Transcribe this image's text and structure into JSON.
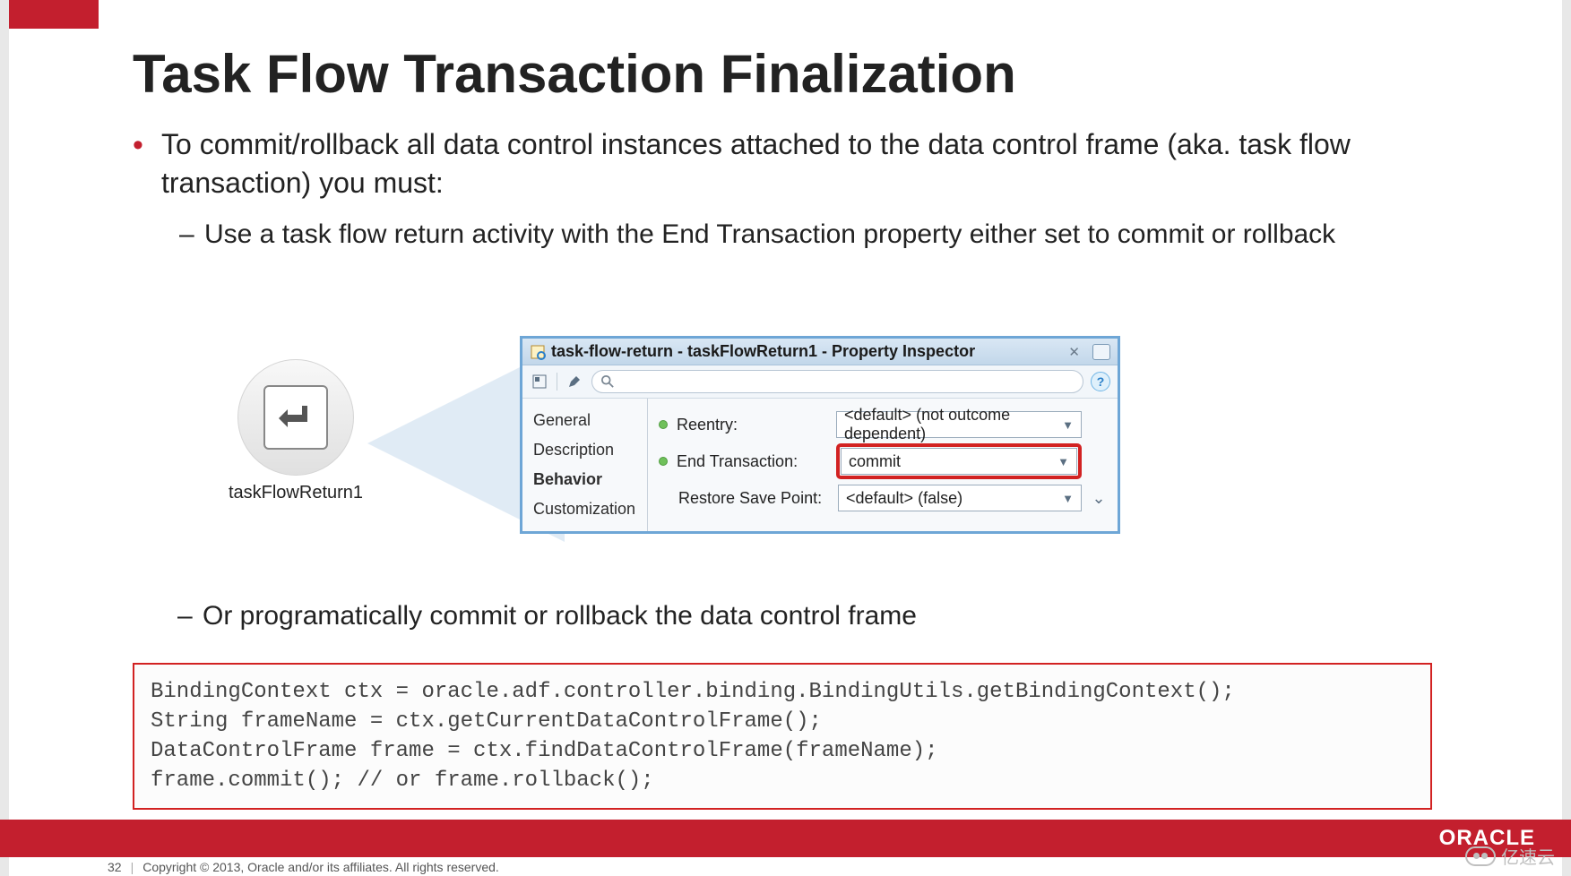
{
  "slide": {
    "title": "Task Flow Transaction Finalization",
    "bullet1": "To commit/rollback all data control instances attached to the data control frame (aka. task flow transaction) you must:",
    "sub1": "Use a task flow return activity with the End Transaction property either set to commit or rollback",
    "sub2": "Or programatically commit or rollback the data control frame"
  },
  "activity": {
    "label": "taskFlowReturn1"
  },
  "inspector": {
    "title": "task-flow-return - taskFlowReturn1 - Property Inspector",
    "tabs": {
      "general": "General",
      "description": "Description",
      "behavior": "Behavior",
      "customization": "Customization"
    },
    "props": {
      "reentry_label": "Reentry:",
      "reentry_value": "<default> (not outcome dependent)",
      "endtx_label": "End Transaction:",
      "endtx_value": "commit",
      "restore_label": "Restore Save Point:",
      "restore_value": "<default> (false)"
    },
    "help": "?"
  },
  "code": {
    "line1": "BindingContext ctx = oracle.adf.controller.binding.BindingUtils.getBindingContext();",
    "line2": "String frameName = ctx.getCurrentDataControlFrame();",
    "line3": "DataControlFrame frame = ctx.findDataControlFrame(frameName);",
    "line4": "frame.commit(); // or frame.rollback();"
  },
  "footer": {
    "page": "32",
    "copyright": "Copyright © 2013, Oracle and/or its affiliates. All rights reserved."
  },
  "brand": {
    "oracle": "ORACLE"
  },
  "watermark": {
    "text": "亿速云"
  }
}
